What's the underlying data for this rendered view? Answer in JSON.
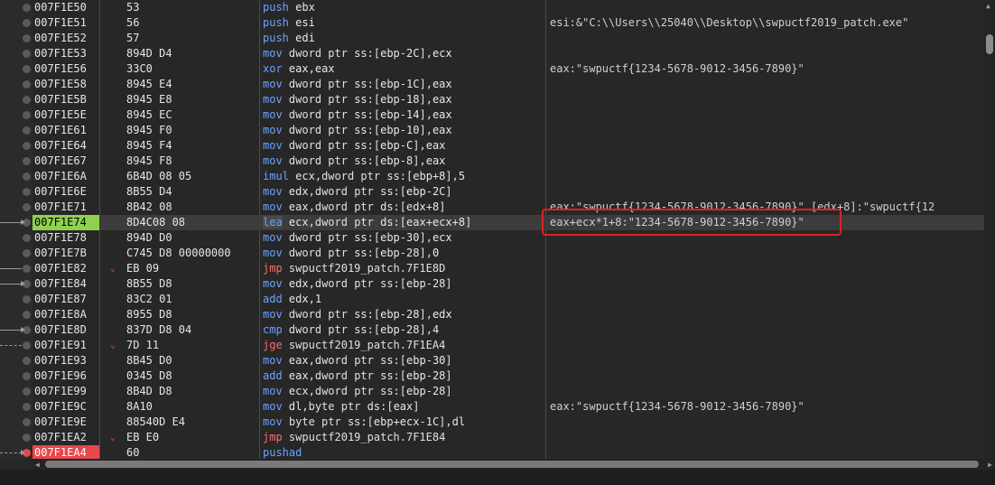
{
  "rows": [
    {
      "addr": "007F1E50",
      "bytes": "53",
      "mn": "push",
      "ops": "ebx",
      "comment": ""
    },
    {
      "addr": "007F1E51",
      "bytes": "56",
      "mn": "push",
      "ops": "esi",
      "comment": "esi:&\"C:\\\\Users\\\\25040\\\\Desktop\\\\swpuctf2019_patch.exe\""
    },
    {
      "addr": "007F1E52",
      "bytes": "57",
      "mn": "push",
      "ops": "edi",
      "comment": ""
    },
    {
      "addr": "007F1E53",
      "bytes": "894D D4",
      "mn": "mov",
      "ops": "dword ptr ss:[ebp-2C],ecx",
      "comment": ""
    },
    {
      "addr": "007F1E56",
      "bytes": "33C0",
      "mn": "xor",
      "ops": "eax,eax",
      "comment": "eax:\"swpuctf{1234-5678-9012-3456-7890}\""
    },
    {
      "addr": "007F1E58",
      "bytes": "8945 E4",
      "mn": "mov",
      "ops": "dword ptr ss:[ebp-1C],eax",
      "comment": ""
    },
    {
      "addr": "007F1E5B",
      "bytes": "8945 E8",
      "mn": "mov",
      "ops": "dword ptr ss:[ebp-18],eax",
      "comment": ""
    },
    {
      "addr": "007F1E5E",
      "bytes": "8945 EC",
      "mn": "mov",
      "ops": "dword ptr ss:[ebp-14],eax",
      "comment": ""
    },
    {
      "addr": "007F1E61",
      "bytes": "8945 F0",
      "mn": "mov",
      "ops": "dword ptr ss:[ebp-10],eax",
      "comment": ""
    },
    {
      "addr": "007F1E64",
      "bytes": "8945 F4",
      "mn": "mov",
      "ops": "dword ptr ss:[ebp-C],eax",
      "comment": ""
    },
    {
      "addr": "007F1E67",
      "bytes": "8945 F8",
      "mn": "mov",
      "ops": "dword ptr ss:[ebp-8],eax",
      "comment": ""
    },
    {
      "addr": "007F1E6A",
      "bytes": "6B4D 08 05",
      "mn": "imul",
      "ops": "ecx,dword ptr ss:[ebp+8],5",
      "comment": ""
    },
    {
      "addr": "007F1E6E",
      "bytes": "8B55 D4",
      "mn": "mov",
      "ops": "edx,dword ptr ss:[ebp-2C]",
      "comment": ""
    },
    {
      "addr": "007F1E71",
      "bytes": "8B42 08",
      "mn": "mov",
      "ops": "eax,dword ptr ds:[edx+8]",
      "comment": "eax:\"swpuctf{1234-5678-9012-3456-7890}\"  [edx+8]:\"swpuctf{12"
    },
    {
      "addr": "007F1E74",
      "bytes": "8D4C08 08",
      "mn": "lea",
      "ops": "ecx,dword ptr ds:[eax+ecx+8]",
      "comment": "eax+ecx*1+8:\"1234-5678-9012-3456-7890}\""
    },
    {
      "addr": "007F1E78",
      "bytes": "894D D0",
      "mn": "mov",
      "ops": "dword ptr ss:[ebp-30],ecx",
      "comment": ""
    },
    {
      "addr": "007F1E7B",
      "bytes": "C745 D8 00000000",
      "mn": "mov",
      "ops": "dword ptr ss:[ebp-28],0",
      "comment": ""
    },
    {
      "addr": "007F1E82",
      "bytes": "EB 09",
      "mn": "jmp",
      "ops": "swpuctf2019_patch.7F1E8D",
      "comment": ""
    },
    {
      "addr": "007F1E84",
      "bytes": "8B55 D8",
      "mn": "mov",
      "ops": "edx,dword ptr ss:[ebp-28]",
      "comment": ""
    },
    {
      "addr": "007F1E87",
      "bytes": "83C2 01",
      "mn": "add",
      "ops": "edx,1",
      "comment": ""
    },
    {
      "addr": "007F1E8A",
      "bytes": "8955 D8",
      "mn": "mov",
      "ops": "dword ptr ss:[ebp-28],edx",
      "comment": ""
    },
    {
      "addr": "007F1E8D",
      "bytes": "837D D8 04",
      "mn": "cmp",
      "ops": "dword ptr ss:[ebp-28],4",
      "comment": ""
    },
    {
      "addr": "007F1E91",
      "bytes": "7D 11",
      "mn": "jge",
      "ops": "swpuctf2019_patch.7F1EA4",
      "comment": ""
    },
    {
      "addr": "007F1E93",
      "bytes": "8B45 D0",
      "mn": "mov",
      "ops": "eax,dword ptr ss:[ebp-30]",
      "comment": ""
    },
    {
      "addr": "007F1E96",
      "bytes": "0345 D8",
      "mn": "add",
      "ops": "eax,dword ptr ss:[ebp-28]",
      "comment": ""
    },
    {
      "addr": "007F1E99",
      "bytes": "8B4D D8",
      "mn": "mov",
      "ops": "ecx,dword ptr ss:[ebp-28]",
      "comment": ""
    },
    {
      "addr": "007F1E9C",
      "bytes": "8A10",
      "mn": "mov",
      "ops": "dl,byte ptr ds:[eax]",
      "comment": "eax:\"swpuctf{1234-5678-9012-3456-7890}\""
    },
    {
      "addr": "007F1E9E",
      "bytes": "88540D E4",
      "mn": "mov",
      "ops": "byte ptr ss:[ebp+ecx-1C],dl",
      "comment": ""
    },
    {
      "addr": "007F1EA2",
      "bytes": "EB E0",
      "mn": "jmp",
      "ops": "swpuctf2019_patch.7F1E84",
      "comment": ""
    },
    {
      "addr": "007F1EA4",
      "bytes": "60",
      "mn": "pushad",
      "ops": "",
      "comment": ""
    }
  ],
  "colors": {
    "current_addr_bg": "#8fd14f",
    "breakpoint_bg": "#e8474c",
    "mnemonic": "#6aa3ff",
    "jump_mnemonic": "#ff6a6a",
    "highlight_box": "#e02020"
  }
}
